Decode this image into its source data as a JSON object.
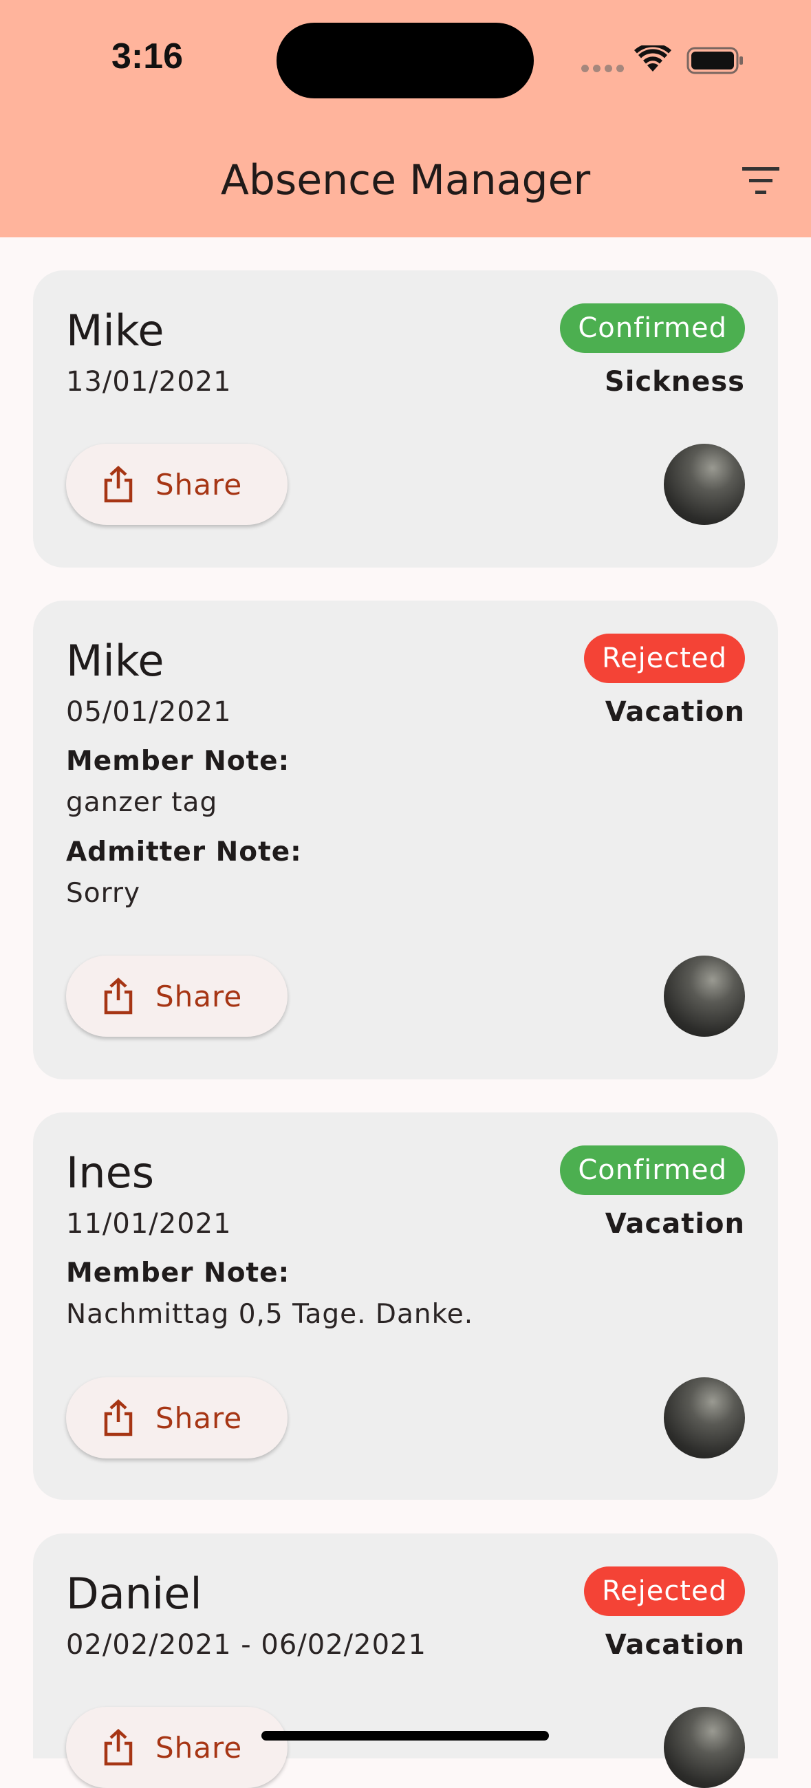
{
  "status_bar": {
    "time": "3:16"
  },
  "app_bar": {
    "title": "Absence Manager",
    "filter_icon": "filter-list-icon",
    "background": "#ffb49c"
  },
  "absences": [
    {
      "name": "Mike",
      "date": "13/01/2021",
      "status": "Confirmed",
      "status_color": "#4caf50",
      "type": "Sickness",
      "share_label": "Share"
    },
    {
      "name": "Mike",
      "date": "05/01/2021",
      "status": "Rejected",
      "status_color": "#f44336",
      "type": "Vacation",
      "member_note_label": "Member Note:",
      "member_note": "ganzer tag",
      "admitter_note_label": "Admitter Note:",
      "admitter_note": "Sorry",
      "share_label": "Share"
    },
    {
      "name": "Ines",
      "date": "11/01/2021",
      "status": "Confirmed",
      "status_color": "#4caf50",
      "type": "Vacation",
      "member_note_label": "Member Note:",
      "member_note": "Nachmittag 0,5 Tage. Danke.",
      "share_label": "Share"
    },
    {
      "name": "Daniel",
      "date": "02/02/2021 - 06/02/2021",
      "status": "Rejected",
      "status_color": "#f44336",
      "type": "Vacation",
      "share_label": "Share"
    }
  ]
}
